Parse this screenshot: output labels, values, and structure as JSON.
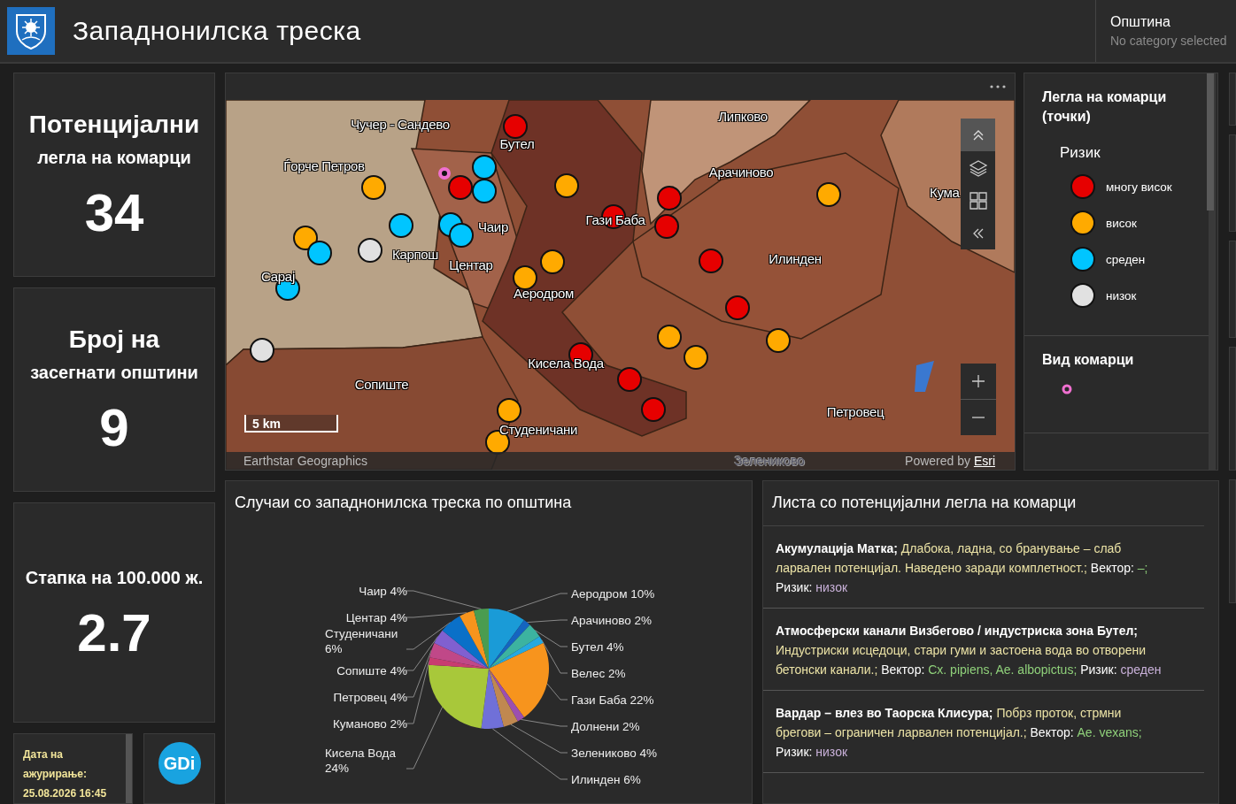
{
  "header": {
    "title": "Западнонилска треска",
    "filter": {
      "label": "Општина",
      "placeholder": "No category selected"
    }
  },
  "stats": [
    {
      "title": [
        "Потенцијални",
        "легла на комарци"
      ],
      "value": "34"
    },
    {
      "title": [
        "Број на",
        "засегнати општини"
      ],
      "value": "9"
    },
    {
      "title": [
        "Стапка на 100.000 ж."
      ],
      "value": "2.7"
    }
  ],
  "update_note": "Дата на ажурирање: 25.08.2026 16:45",
  "company_logo": "GDi",
  "map": {
    "labels": [
      "Чучер - Сандево",
      "Бутел",
      "Ѓорче Петров",
      "Липково",
      "Арачиново",
      "Кума",
      "Гази Баба",
      "Чаир",
      "Карпош",
      "Центар",
      "Сарај",
      "Аеродром",
      "Илинден",
      "Кисела Вода",
      "Сопиште",
      "Петровец",
      "Студеничани",
      "Зелениково"
    ],
    "markers": [
      {
        "color": "#e60000"
      },
      {
        "color": "#e60000"
      },
      {
        "color": "#e60000"
      },
      {
        "color": "#e60000"
      },
      {
        "color": "#e60000"
      },
      {
        "color": "#e60000"
      },
      {
        "color": "#e60000"
      },
      {
        "color": "#e60000"
      },
      {
        "color": "#e60000"
      },
      {
        "color": "#e60000"
      },
      {
        "color": "#ffaa00"
      },
      {
        "color": "#ffaa00"
      },
      {
        "color": "#ffaa00"
      },
      {
        "color": "#ffaa00"
      },
      {
        "color": "#ffaa00"
      },
      {
        "color": "#ffaa00"
      },
      {
        "color": "#ffaa00"
      },
      {
        "color": "#ffaa00"
      },
      {
        "color": "#ffaa00"
      },
      {
        "color": "#ffaa00"
      },
      {
        "color": "#ffaa00"
      },
      {
        "color": "#00c5ff"
      },
      {
        "color": "#00c5ff"
      },
      {
        "color": "#00c5ff"
      },
      {
        "color": "#00c5ff"
      },
      {
        "color": "#00c5ff"
      },
      {
        "color": "#00c5ff"
      },
      {
        "color": "#00c5ff"
      },
      {
        "color": "#e1e1e1"
      },
      {
        "color": "#e1e1e1"
      }
    ],
    "scale": "5 km",
    "attribution": "Earthstar Geographics",
    "powered_by": "Powered by",
    "esri_link": "Esri"
  },
  "legend": {
    "title": "Легла на комарци (точки)",
    "field": "Ризик",
    "items": [
      {
        "label": "многу висок",
        "color": "#e60000"
      },
      {
        "label": "висок",
        "color": "#ffaa00"
      },
      {
        "label": "среден",
        "color": "#00c5ff"
      },
      {
        "label": "низок",
        "color": "#e1e1e1"
      }
    ],
    "second_title": "Вид комарци"
  },
  "pie_panel": {
    "title": "Случаи со западнонилска треска по општина",
    "chart_data": {
      "type": "pie",
      "categories": [
        "Аеродром",
        "Арачиново",
        "Бутел",
        "Велес",
        "Гази Баба",
        "Долнени",
        "Зелениково",
        "Илинден",
        "Кисела Вода",
        "Куманово",
        "Петровец",
        "Сопиште",
        "Студеничани",
        "Центар",
        "Чаир"
      ],
      "values": [
        10,
        2,
        4,
        2,
        22,
        2,
        4,
        6,
        24,
        2,
        4,
        4,
        6,
        4,
        4
      ],
      "value_labels": [
        "10%",
        "2%",
        "4%",
        "2%",
        "22%",
        "2%",
        "4%",
        "6%",
        "24%",
        "2%",
        "4%",
        "4%",
        "6%",
        "4%",
        "4%"
      ]
    }
  },
  "list_panel": {
    "title": "Листа со потенцијални легла на комарци",
    "items": [
      {
        "name": "Акумулација Матка;",
        "description": "Длабока, ладна, со бранување – слаб ларвален потенцијал. Наведено заради комплетност.;",
        "vector_label": "Вектор:",
        "vector": "–;",
        "risk_label": "Ризик:",
        "risk": "низок"
      },
      {
        "name": "Атмосферски канали Визбегово / индустриска зона Бутел;",
        "description": "Индустриски исцедоци, стари гуми и застоена вода во отворени бетонски канали.;",
        "vector_label": "Вектор:",
        "vector": "Cx. pipiens, Ae. albopictus;",
        "risk_label": "Ризик:",
        "risk": "среден"
      },
      {
        "name": "Вардар – влез во Таорска Клисура;",
        "description": "Побрз проток, стрмни брегови – ограничен ларвален потенцијал.;",
        "vector_label": "Вектор:",
        "vector": "Ae. vexans;",
        "risk_label": "Ризик:",
        "risk": "низок"
      }
    ]
  }
}
